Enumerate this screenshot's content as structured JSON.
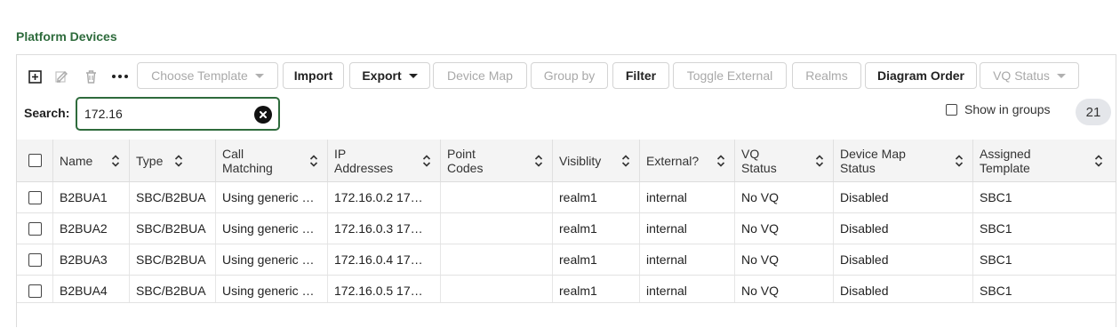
{
  "page": {
    "title": "Platform Devices"
  },
  "toolbar": {
    "icons": [
      "add-icon",
      "edit-icon",
      "trash-icon",
      "more-icon"
    ],
    "choose_template": "Choose Template",
    "import": "Import",
    "export": "Export",
    "device_map": "Device Map",
    "group_by": "Group by",
    "filter": "Filter",
    "toggle_external": "Toggle External",
    "realms": "Realms",
    "diagram_order": "Diagram Order",
    "vq_status": "VQ Status"
  },
  "search": {
    "label": "Search:",
    "value": "172.16"
  },
  "show_in_groups": {
    "label": "Show in groups",
    "checked": false
  },
  "count": "21",
  "table": {
    "headers": {
      "name": "Name",
      "type": "Type",
      "call_matching": "Call Matching",
      "ip_addresses": "IP Addresses",
      "point_codes": "Point Codes",
      "visibility": "Visiblity",
      "external": "External?",
      "vq_status": "VQ Status",
      "device_map_status": "Device Map Status",
      "assigned_template": "Assigned Template"
    },
    "rows": [
      {
        "name": "B2BUA1",
        "type": "SBC/B2BUA",
        "call_matching": "Using generic …",
        "ip": "172.16.0.2 17…",
        "point_codes": "",
        "visibility": "realm1",
        "external": "internal",
        "vq": "No VQ",
        "map_status": "Disabled",
        "template": "SBC1"
      },
      {
        "name": "B2BUA2",
        "type": "SBC/B2BUA",
        "call_matching": "Using generic …",
        "ip": "172.16.0.3 17…",
        "point_codes": "",
        "visibility": "realm1",
        "external": "internal",
        "vq": "No VQ",
        "map_status": "Disabled",
        "template": "SBC1"
      },
      {
        "name": "B2BUA3",
        "type": "SBC/B2BUA",
        "call_matching": "Using generic …",
        "ip": "172.16.0.4 17…",
        "point_codes": "",
        "visibility": "realm1",
        "external": "internal",
        "vq": "No VQ",
        "map_status": "Disabled",
        "template": "SBC1"
      },
      {
        "name": "B2BUA4",
        "type": "SBC/B2BUA",
        "call_matching": "Using generic …",
        "ip": "172.16.0.5 17…",
        "point_codes": "",
        "visibility": "realm1",
        "external": "internal",
        "vq": "No VQ",
        "map_status": "Disabled",
        "template": "SBC1"
      }
    ]
  },
  "colors": {
    "accent": "#2e6b3c",
    "disabled_text": "#a9a9a9",
    "header_bg": "#f4f4f4"
  }
}
